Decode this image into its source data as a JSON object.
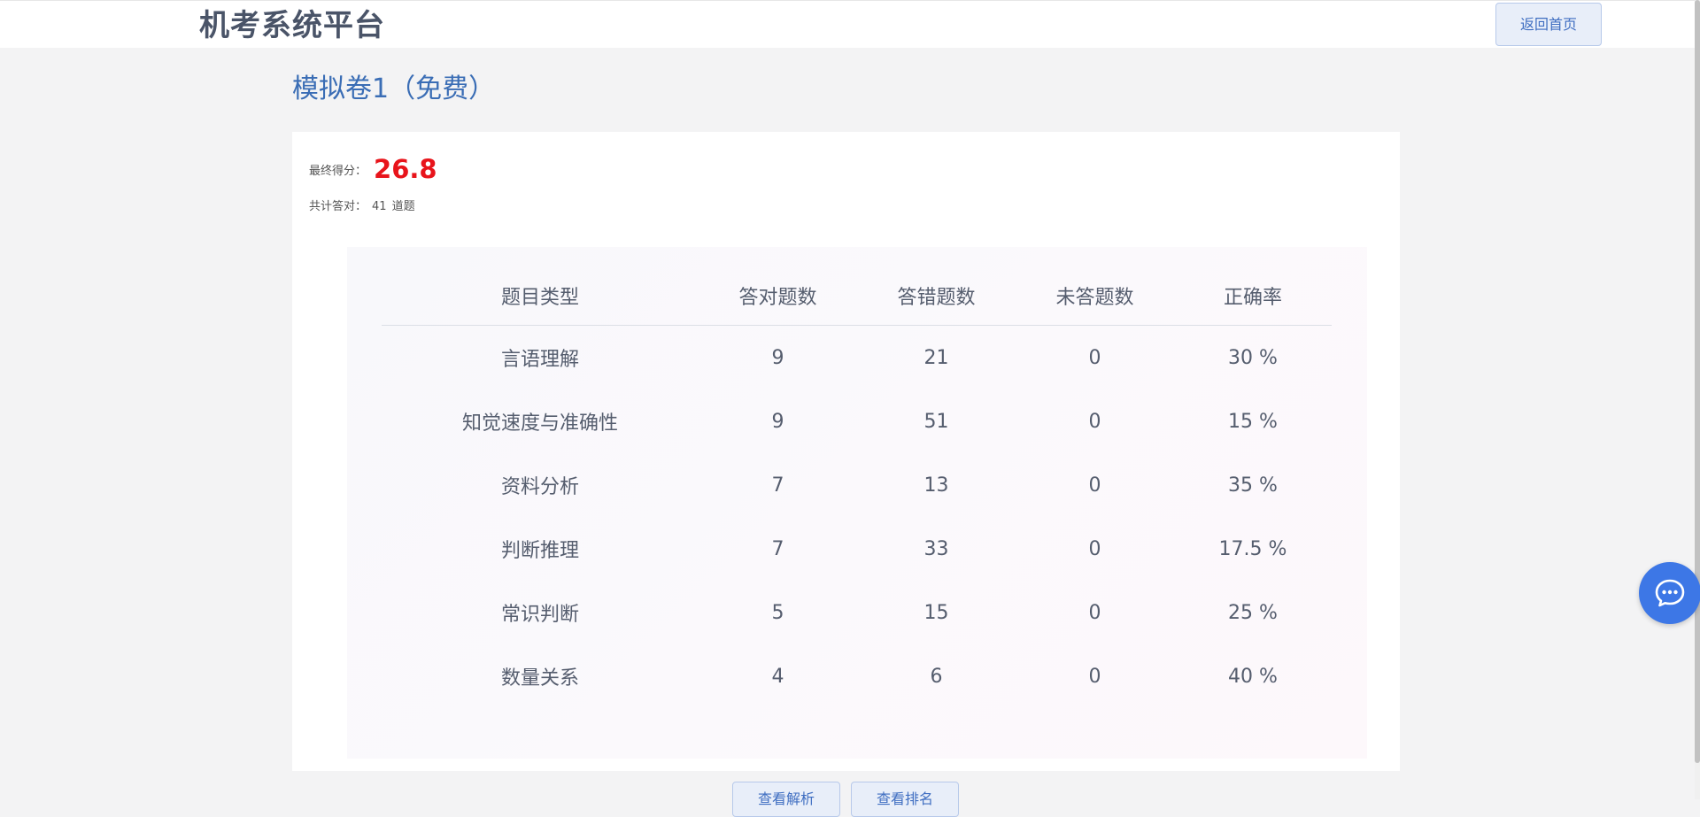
{
  "header": {
    "app_title": "机考系统平台",
    "home_button": "返回首页"
  },
  "exam": {
    "title": "模拟卷1（免费）"
  },
  "summary": {
    "score_label": "最终得分：",
    "score_value": "26.8",
    "correct_label": "共计答对：",
    "correct_count": "41",
    "correct_unit": "道题"
  },
  "table": {
    "headers": [
      "题目类型",
      "答对题数",
      "答错题数",
      "未答题数",
      "正确率"
    ],
    "rows": [
      [
        "言语理解",
        "9",
        "21",
        "0",
        "30 %"
      ],
      [
        "知觉速度与准确性",
        "9",
        "51",
        "0",
        "15 %"
      ],
      [
        "资料分析",
        "7",
        "13",
        "0",
        "35 %"
      ],
      [
        "判断推理",
        "7",
        "33",
        "0",
        "17.5 %"
      ],
      [
        "常识判断",
        "5",
        "15",
        "0",
        "25 %"
      ],
      [
        "数量关系",
        "4",
        "6",
        "0",
        "40 %"
      ]
    ]
  },
  "footer_buttons": [
    "查看解析",
    "查看排名"
  ],
  "chat": {
    "icon": "chat-bubble-icon"
  },
  "colors": {
    "accent": "#3a6db5",
    "score": "#e8141b",
    "button_bg": "#e8eef9",
    "chat_fab": "#3d77e6"
  }
}
